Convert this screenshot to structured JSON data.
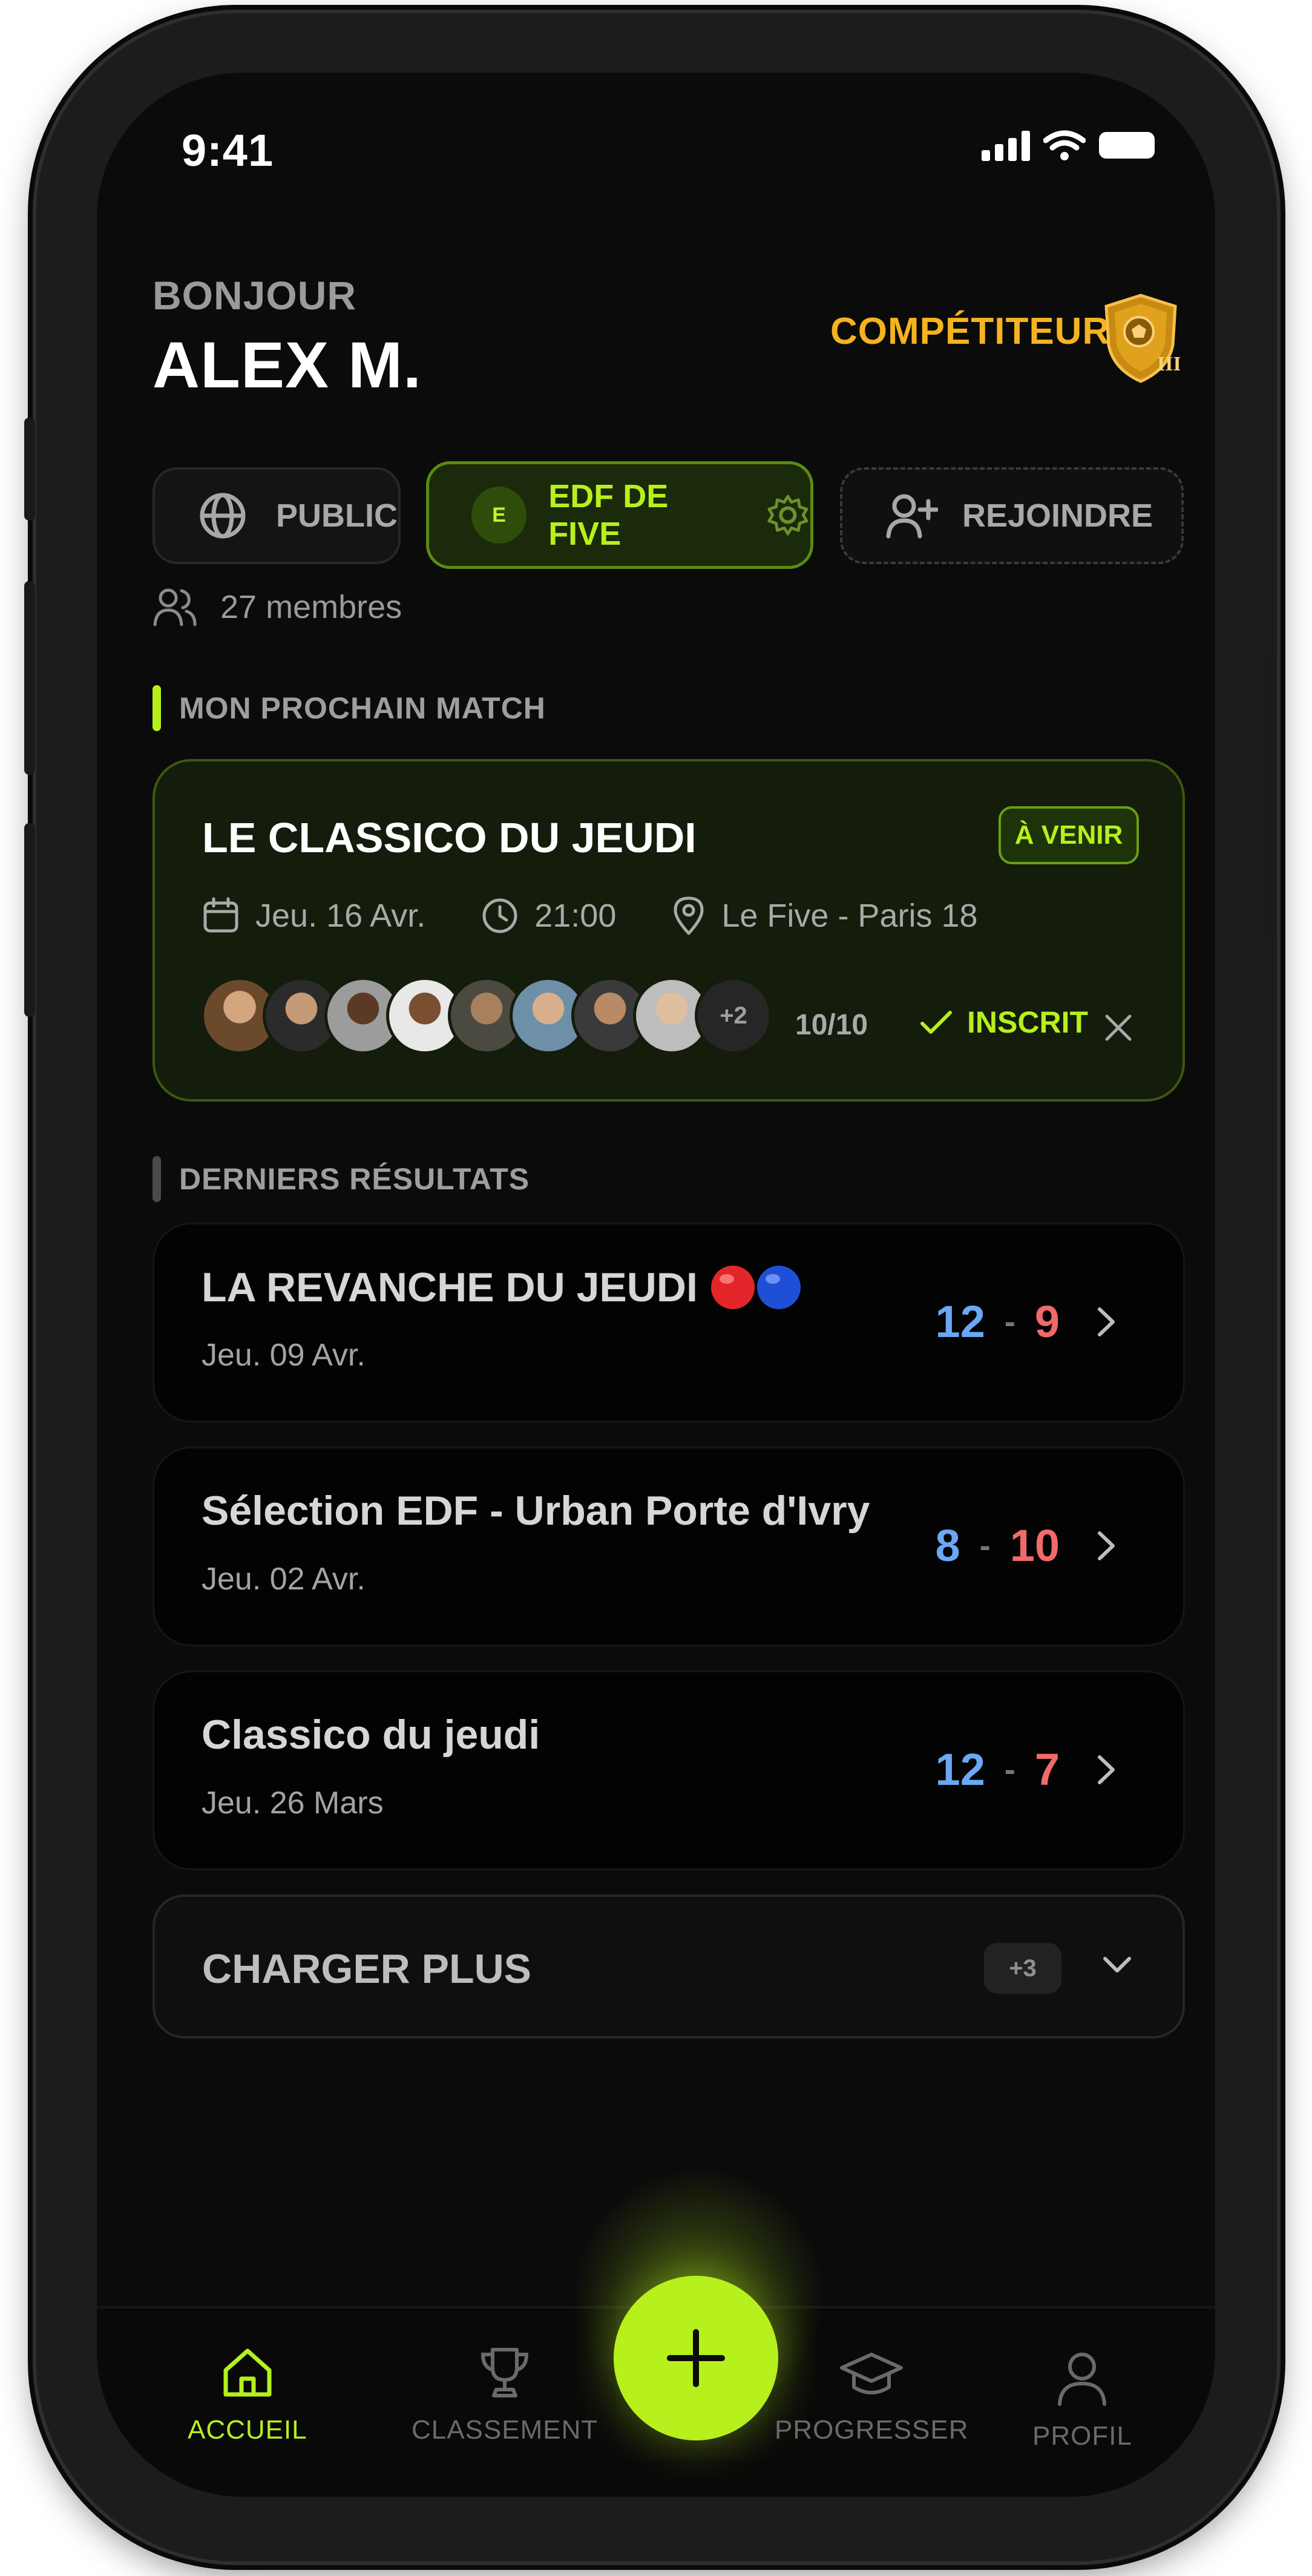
{
  "status_bar": {
    "time": "9:41"
  },
  "header": {
    "greeting": "BONJOUR",
    "user_name": "ALEX M.",
    "rank_label": "COMPÉTITEUR III",
    "shield_icon": "shield-icon"
  },
  "groups": {
    "public_label": "PUBLIC",
    "active_group_initial": "E",
    "active_group_label": "EDF DE FIVE",
    "join_label": "REJOINDRE",
    "members_text": "27 membres"
  },
  "next_match": {
    "section_title": "MON PROCHAIN MATCH",
    "title": "LE CLASSICO DU JEUDI",
    "badge": "À VENIR",
    "date": "Jeu. 16 Avr.",
    "time": "21:00",
    "location": "Le Five - Paris 18",
    "extra_players": "+2",
    "player_count": "10/10",
    "status": "INSCRIT"
  },
  "results": {
    "section_title": "DERNIERS RÉSULTATS",
    "items": [
      {
        "title": "LA REVANCHE DU JEUDI",
        "date": "Jeu. 09 Avr.",
        "score_blue": "12",
        "score_red": "9"
      },
      {
        "title": "Sélection EDF - Urban Porte d'Ivry",
        "date": "Jeu. 02 Avr.",
        "score_blue": "8",
        "score_red": "10"
      },
      {
        "title": "Classico du jeudi",
        "date": "Jeu. 26 Mars",
        "score_blue": "12",
        "score_red": "7"
      }
    ],
    "separator": "-",
    "load_more_label": "CHARGER PLUS",
    "load_more_count": "+3"
  },
  "nav": {
    "home": "ACCUEIL",
    "ranking": "CLASSEMENT",
    "progress": "PROGRESSER",
    "profile": "PROFIL"
  },
  "colors": {
    "accent": "#b6f01d",
    "gold": "#f5b31f",
    "score_blue": "#6aa8f4",
    "score_red": "#f06a6a",
    "background": "#0b0b0b"
  }
}
